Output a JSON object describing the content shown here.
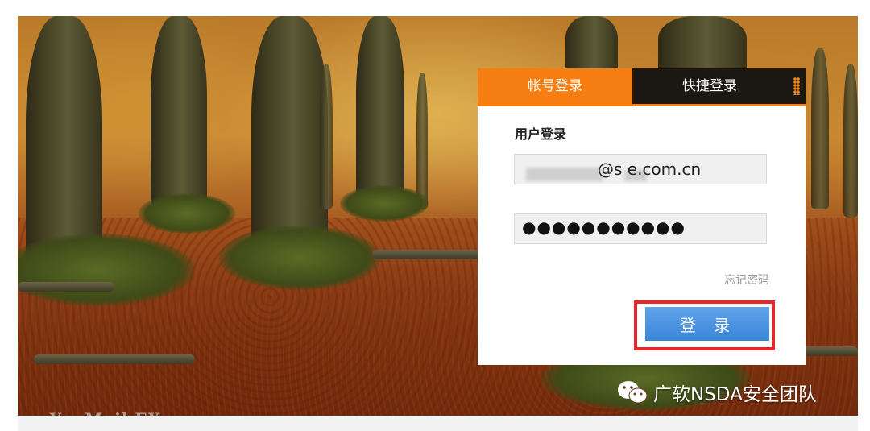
{
  "login": {
    "tabs": {
      "account": "帐号登录",
      "quick": "快捷登录"
    },
    "title": "用户登录",
    "username_value": "@s e.com.cn",
    "password_value": "●●●●●●●●●●●",
    "forgot_label": "忘记密码",
    "submit_label": "登 录"
  },
  "branding": {
    "product_watermark": "eYouMail EX",
    "wechat_watermark": "广软NSDA安全团队"
  },
  "colors": {
    "accent_orange": "#f57d11",
    "tab_dark": "#1b1712",
    "button_blue": "#3b85d8",
    "highlight_red": "#e8262b"
  }
}
